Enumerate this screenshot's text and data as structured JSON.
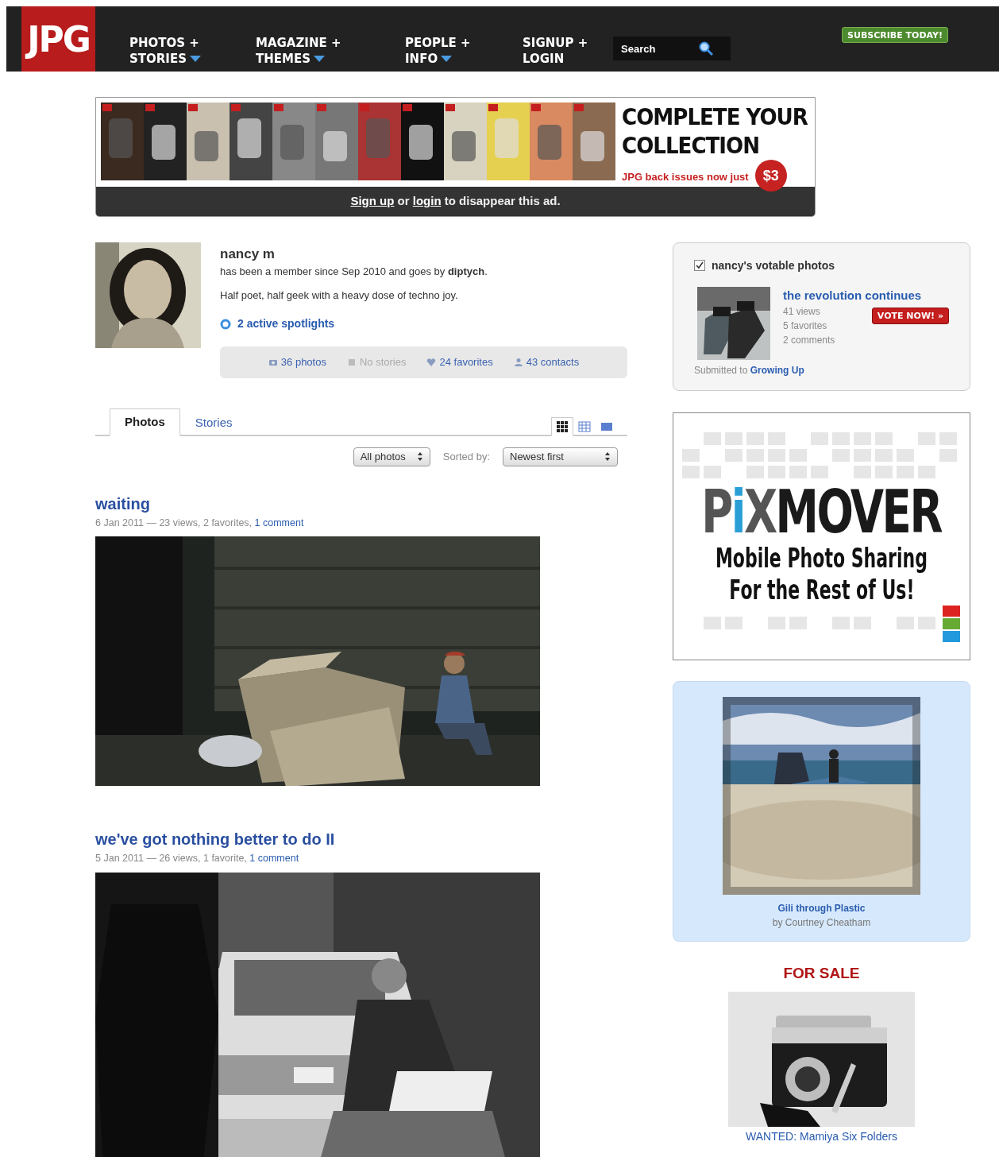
{
  "header": {
    "logo": "JPG",
    "nav": [
      {
        "line1": "PHOTOS +",
        "line2": "STORIES",
        "dropdown": true
      },
      {
        "line1": "MAGAZINE +",
        "line2": "THEMES",
        "dropdown": true
      },
      {
        "line1": "PEOPLE +",
        "line2": "INFO",
        "dropdown": true
      },
      {
        "line1": "SIGNUP +",
        "line2": "LOGIN",
        "dropdown": false
      }
    ],
    "search": {
      "placeholder": "Search"
    },
    "promo": "SUBSCRIBE TODAY!"
  },
  "ad_banner": {
    "headline": [
      "COMPLETE YOUR",
      "COLLECTION"
    ],
    "subline": "JPG back issues now just",
    "price": "$3",
    "footer": [
      {
        "kind": "link",
        "text": "Sign up"
      },
      {
        "kind": "text",
        "text": " or "
      },
      {
        "kind": "link",
        "text": "login"
      },
      {
        "kind": "text",
        "text": " to disappear this ad."
      }
    ]
  },
  "profile": {
    "name": "nancy m",
    "member_line": "has been a member since Sep 2010 and goes by **diptych**.",
    "bio": "Half poet, half geek with a heavy dose of techno joy.",
    "spotlights": "2 active spotlights",
    "stats": [
      {
        "kind": "photos",
        "label": "36 photos",
        "disabled": false
      },
      {
        "kind": "stories",
        "label": "No stories",
        "disabled": true
      },
      {
        "kind": "favorites",
        "label": "24 favorites",
        "disabled": false
      },
      {
        "kind": "contacts",
        "label": "43 contacts",
        "disabled": false
      }
    ]
  },
  "tabs": [
    {
      "label": "Photos",
      "selected": true
    },
    {
      "label": "Stories",
      "selected": false
    }
  ],
  "view_modes": [
    {
      "kind": "grid",
      "selected": true
    },
    {
      "kind": "list",
      "selected": false
    },
    {
      "kind": "large",
      "selected": false
    }
  ],
  "filters": {
    "show": "All photos",
    "sort_label": "Sorted by:",
    "sort": "Newest first"
  },
  "posts": [
    {
      "title": "waiting",
      "meta": "6 Jan 2011 — 23 views, 2 favorites, ",
      "comments": "1 comment"
    },
    {
      "title": "we've got nothing better to do II",
      "meta": "5 Jan 2011 — 26 views, 1 favorite, ",
      "comments": "1 comment"
    }
  ],
  "sidebar": {
    "votable": {
      "checked": true,
      "title": "nancy's votable photos",
      "photo_title": "the revolution continues",
      "stats": [
        "41 views",
        "5 favorites",
        "2 comments"
      ],
      "button": "VOTE NOW! »",
      "submitted": "Submitted to ",
      "group": "Growing Up"
    },
    "pixmover": {
      "logo": [
        {
          "text": "P",
          "color": "#555555"
        },
        {
          "text": "i",
          "color": "#2a9fd6"
        },
        {
          "text": "X",
          "color": "#555555"
        },
        {
          "text": "MOVER",
          "color": "#1a1a1a"
        }
      ],
      "lines": [
        "Mobile Photo Sharing",
        "For the Rest of Us!"
      ]
    },
    "featured": {
      "title": "Gili through Plastic",
      "byline": "by Courtney Cheatham"
    },
    "for_sale": {
      "heading": "FOR SALE",
      "caption": "WANTED: Mamiya Six Folders"
    }
  }
}
